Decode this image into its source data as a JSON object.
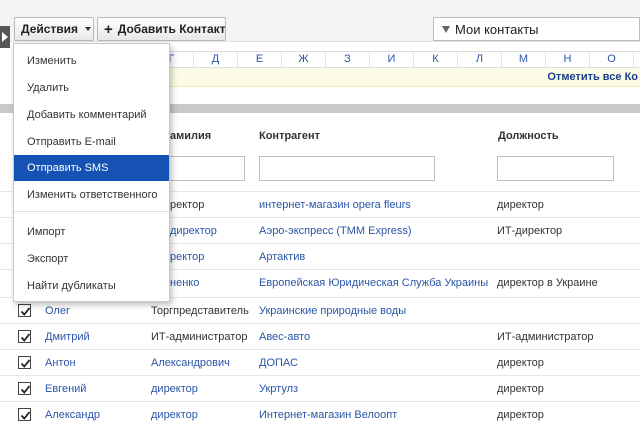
{
  "toolbar": {
    "actions_label": "Действия",
    "add_contact_label": "Добавить Контакт",
    "filter_value": "Мои контакты"
  },
  "alphabet": [
    "Г",
    "Д",
    "Е",
    "Ж",
    "З",
    "И",
    "К",
    "Л",
    "М",
    "Н",
    "О"
  ],
  "notice": "Отметить все Ко",
  "columns": {
    "lastname": "амилия",
    "company": "Контрагент",
    "position": "Должность"
  },
  "menu": {
    "items": [
      "Изменить",
      "Удалить",
      "Добавить комментарий",
      "Отправить E-mail",
      "Отправить SMS",
      "Изменить ответственного",
      "Импорт",
      "Экспорт",
      "Найти дубликаты"
    ],
    "active_index": 4
  },
  "rows": [
    {
      "first": "",
      "last": "ректор",
      "company": "интернет-магазин opera fleurs",
      "position": "директор"
    },
    {
      "first": "",
      "last": "директор",
      "company": "Аэро-экспресс (ТММ Express)",
      "position": "ИТ-директор"
    },
    {
      "first": "",
      "last": "ректор",
      "company": "Артактив",
      "position": ""
    },
    {
      "first": "",
      "last": "ненко",
      "company": "Европейская Юридическая Служба Украины",
      "position": "директор в Украине"
    },
    {
      "first": "Олег",
      "last": "Торгпредставитель",
      "company": "Украинские природные воды",
      "position": ""
    },
    {
      "first": "Дмитрий",
      "last": "ИТ-администратор",
      "company": "Авес-авто",
      "position": "ИТ-администратор"
    },
    {
      "first": "Антон",
      "last": "Александрович",
      "company": "ДОПАС",
      "position": "директор"
    },
    {
      "first": "Евгений",
      "last": "директор",
      "company": "Укртулз",
      "position": "директор"
    },
    {
      "first": "Александр",
      "last": "директор",
      "company": "Интернет-магазин Велоопт",
      "position": "директор"
    }
  ]
}
